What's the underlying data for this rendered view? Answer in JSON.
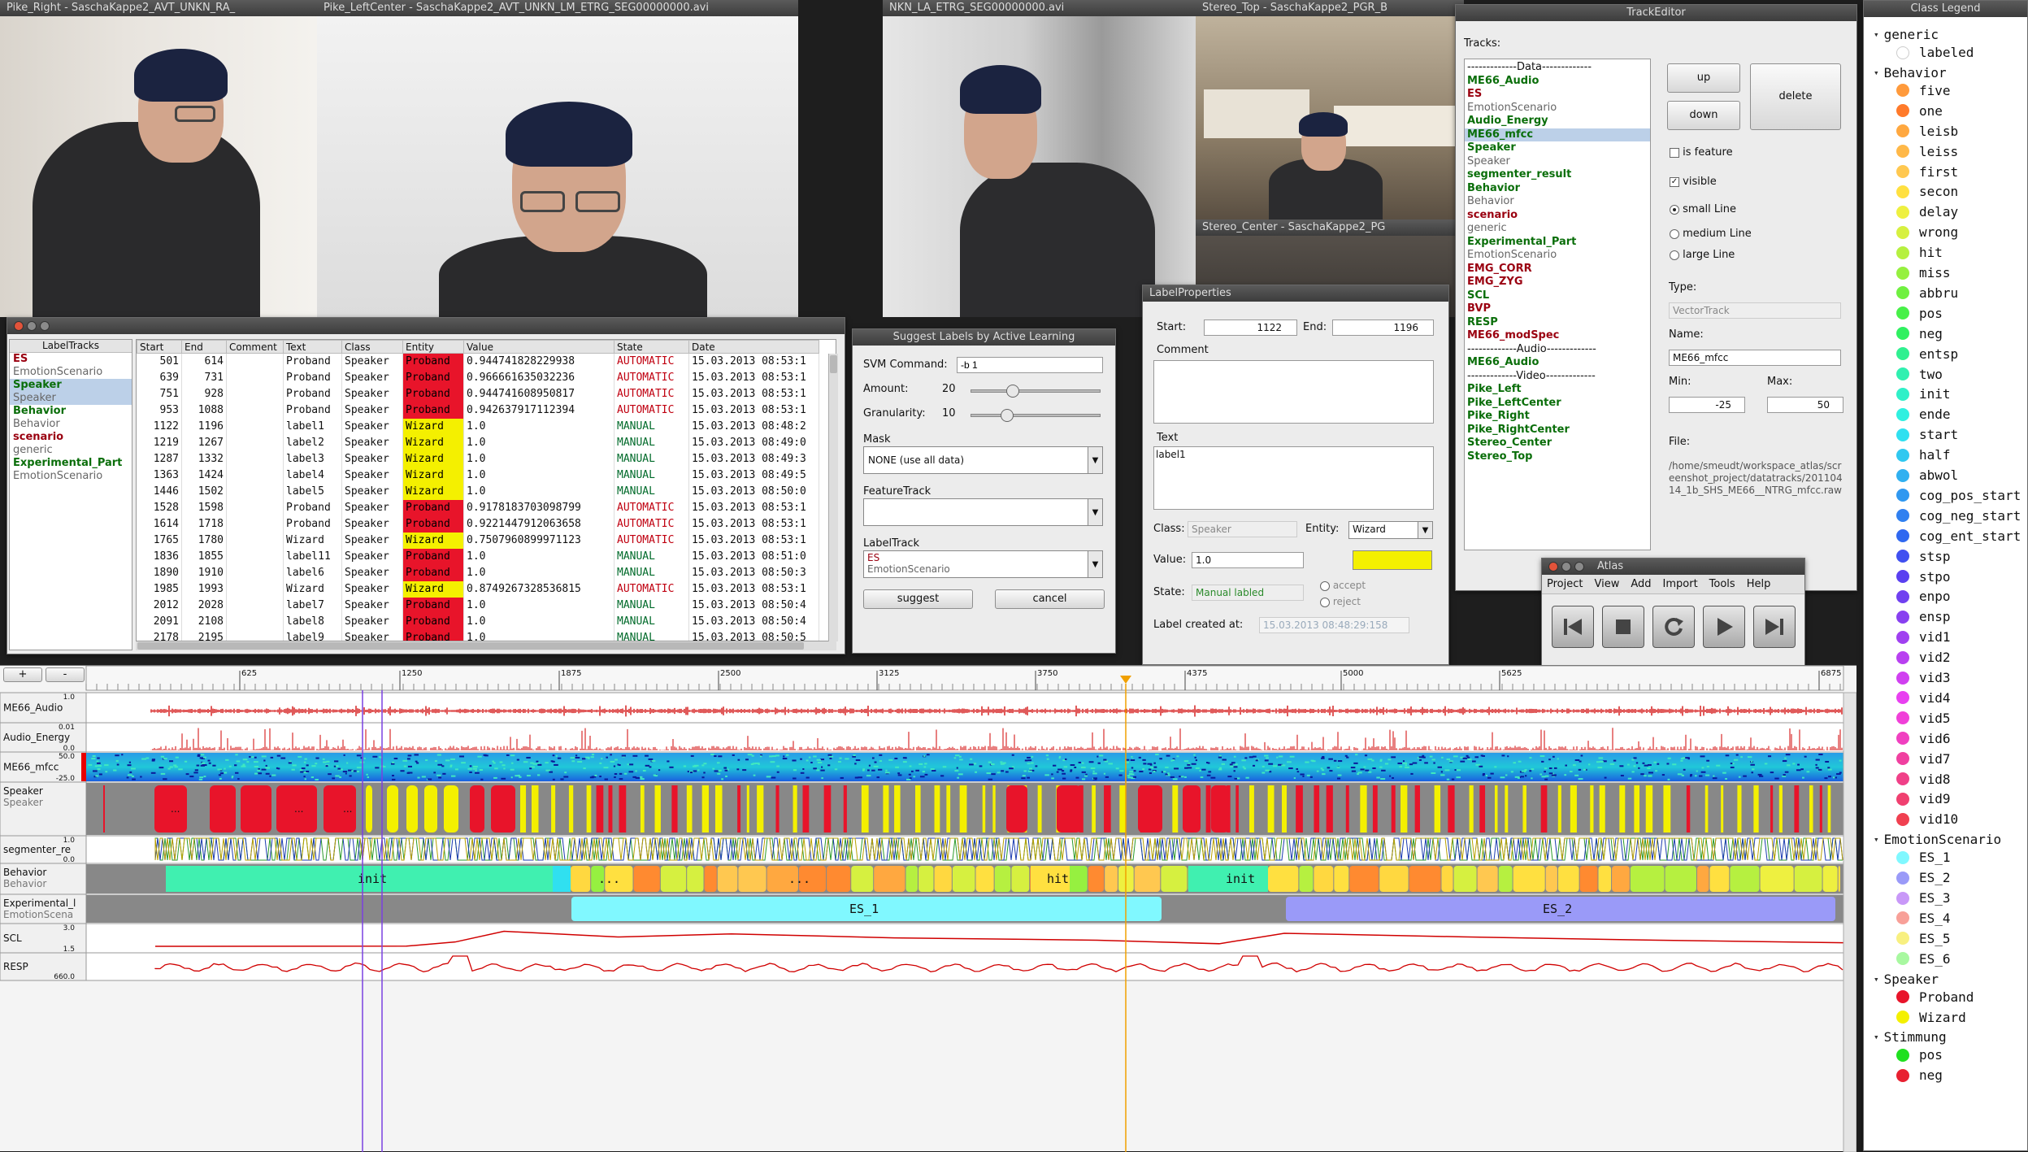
{
  "videos": [
    {
      "title": "Pike_Right - SaschaKappe2_AVT_UNKN_RA_"
    },
    {
      "title": "Pike_LeftCenter - SaschaKappe2_AVT_UNKN_LM_ETRG_SEG00000000.avi"
    },
    {
      "title": "NKN_LA_ETRG_SEG00000000.avi"
    },
    {
      "title": "Stereo_Top - SaschaKappe2_PGR_B"
    },
    {
      "title": "Stereo_Center - SaschaKappe2_PG"
    }
  ],
  "label_tracks": {
    "title": "LabelTracks",
    "items": [
      {
        "name": "ES",
        "sub": "EmotionScenario",
        "color": "#9a0010"
      },
      {
        "name": "Speaker",
        "sub": "Speaker",
        "color": "#0a6e0a"
      },
      {
        "name": "Behavior",
        "sub": "Behavior",
        "color": "#0a6e0a"
      },
      {
        "name": "scenario",
        "sub": "generic",
        "color": "#9a0010"
      },
      {
        "name": "Experimental_Part",
        "sub": "EmotionScenario",
        "color": "#0a6e0a"
      }
    ],
    "columns": [
      "Start",
      "End",
      "Comment",
      "Text",
      "Class",
      "Entity",
      "Value",
      "State",
      "Date"
    ],
    "rows": [
      [
        "501",
        "614",
        "",
        "Proband",
        "Speaker",
        "Proband",
        "0.944741828229938",
        "AUTOMATIC",
        "15.03.2013 08:53:1"
      ],
      [
        "639",
        "731",
        "",
        "Proband",
        "Speaker",
        "Proband",
        "0.966661635032236",
        "AUTOMATIC",
        "15.03.2013 08:53:1"
      ],
      [
        "751",
        "928",
        "",
        "Proband",
        "Speaker",
        "Proband",
        "0.944741608950817",
        "AUTOMATIC",
        "15.03.2013 08:53:1"
      ],
      [
        "953",
        "1088",
        "",
        "Proband",
        "Speaker",
        "Proband",
        "0.942637917112394",
        "AUTOMATIC",
        "15.03.2013 08:53:1"
      ],
      [
        "1122",
        "1196",
        "",
        "label1",
        "Speaker",
        "Wizard",
        "1.0",
        "MANUAL",
        "15.03.2013 08:48:2"
      ],
      [
        "1219",
        "1267",
        "",
        "label2",
        "Speaker",
        "Wizard",
        "1.0",
        "MANUAL",
        "15.03.2013 08:49:0"
      ],
      [
        "1287",
        "1332",
        "",
        "label3",
        "Speaker",
        "Wizard",
        "1.0",
        "MANUAL",
        "15.03.2013 08:49:3"
      ],
      [
        "1363",
        "1424",
        "",
        "label4",
        "Speaker",
        "Wizard",
        "1.0",
        "MANUAL",
        "15.03.2013 08:49:5"
      ],
      [
        "1446",
        "1502",
        "",
        "label5",
        "Speaker",
        "Wizard",
        "1.0",
        "MANUAL",
        "15.03.2013 08:50:0"
      ],
      [
        "1528",
        "1598",
        "",
        "Proband",
        "Speaker",
        "Proband",
        "0.9178183703098799",
        "AUTOMATIC",
        "15.03.2013 08:53:1"
      ],
      [
        "1614",
        "1718",
        "",
        "Proband",
        "Speaker",
        "Proband",
        "0.9221447912063658",
        "AUTOMATIC",
        "15.03.2013 08:53:1"
      ],
      [
        "1765",
        "1780",
        "",
        "Wizard",
        "Speaker",
        "Wizard",
        "0.7507960899971123",
        "AUTOMATIC",
        "15.03.2013 08:53:1"
      ],
      [
        "1836",
        "1855",
        "",
        "label11",
        "Speaker",
        "Proband",
        "1.0",
        "MANUAL",
        "15.03.2013 08:51:0"
      ],
      [
        "1890",
        "1910",
        "",
        "label6",
        "Speaker",
        "Proband",
        "1.0",
        "MANUAL",
        "15.03.2013 08:50:3"
      ],
      [
        "1985",
        "1993",
        "",
        "Wizard",
        "Speaker",
        "Wizard",
        "0.8749267328536815",
        "AUTOMATIC",
        "15.03.2013 08:53:1"
      ],
      [
        "2012",
        "2028",
        "",
        "label7",
        "Speaker",
        "Proband",
        "1.0",
        "MANUAL",
        "15.03.2013 08:50:4"
      ],
      [
        "2091",
        "2108",
        "",
        "label8",
        "Speaker",
        "Proband",
        "1.0",
        "MANUAL",
        "15.03.2013 08:50:4"
      ],
      [
        "2178",
        "2195",
        "",
        "label9",
        "Speaker",
        "Proband",
        "1.0",
        "MANUAL",
        "15.03.2013 08:50:5"
      ]
    ]
  },
  "suggest": {
    "title": "Suggest Labels by Active Learning",
    "svm_label": "SVM Command:",
    "svm_value": "-b 1",
    "amount_label": "Amount:",
    "amount_value": "20",
    "amount_level": 0.3,
    "granularity_label": "Granularity:",
    "granularity_value": "10",
    "granularity_level": 0.25,
    "mask_label": "Mask",
    "mask_value": "NONE (use all data)",
    "feature_label": "FeatureTrack",
    "feature_value": "",
    "labeltrack_label": "LabelTrack",
    "labeltrack_value": "ES",
    "labeltrack_sub": "EmotionScenario",
    "suggest_btn": "suggest",
    "cancel_btn": "cancel"
  },
  "label_props": {
    "title": "LabelProperties",
    "start_label": "Start:",
    "start_value": "1122",
    "end_label": "End:",
    "end_value": "1196",
    "comment_label": "Comment",
    "text_label": "Text",
    "text_value": "label1",
    "class_label": "Class:",
    "class_value": "Speaker",
    "entity_label": "Entity:",
    "entity_value": "Wizard",
    "entity_color": "#f4f000",
    "value_label": "Value:",
    "value_value": "1.0",
    "state_label": "State:",
    "state_value": "Manual labled",
    "accept_label": "accept",
    "reject_label": "reject",
    "created_label": "Label created at:",
    "created_value": "15.03.2013 08:48:29:158"
  },
  "track_editor": {
    "title": "TrackEditor",
    "tracks_label": "Tracks:",
    "items": [
      {
        "text": "-------------Data-------------",
        "kind": "sep"
      },
      {
        "text": "ME66_Audio",
        "kind": "green"
      },
      {
        "text": "ES",
        "kind": "red"
      },
      {
        "text": "EmotionScenario",
        "kind": "gray"
      },
      {
        "text": "Audio_Energy",
        "kind": "green"
      },
      {
        "text": "ME66_mfcc",
        "kind": "green",
        "selected": true
      },
      {
        "text": "Speaker",
        "kind": "green"
      },
      {
        "text": "Speaker",
        "kind": "gray"
      },
      {
        "text": "segmenter_result",
        "kind": "green"
      },
      {
        "text": "Behavior",
        "kind": "green"
      },
      {
        "text": "Behavior",
        "kind": "gray"
      },
      {
        "text": "scenario",
        "kind": "red"
      },
      {
        "text": "generic",
        "kind": "gray"
      },
      {
        "text": "Experimental_Part",
        "kind": "green"
      },
      {
        "text": "EmotionScenario",
        "kind": "gray"
      },
      {
        "text": "EMG_CORR",
        "kind": "red"
      },
      {
        "text": "EMG_ZYG",
        "kind": "red"
      },
      {
        "text": "SCL",
        "kind": "green"
      },
      {
        "text": "BVP",
        "kind": "red"
      },
      {
        "text": "RESP",
        "kind": "green"
      },
      {
        "text": "ME66_modSpec",
        "kind": "red"
      },
      {
        "text": "-------------Audio-------------",
        "kind": "sep"
      },
      {
        "text": "ME66_Audio",
        "kind": "green"
      },
      {
        "text": "-------------Video-------------",
        "kind": "sep"
      },
      {
        "text": "Pike_Left",
        "kind": "green"
      },
      {
        "text": "Pike_LeftCenter",
        "kind": "green"
      },
      {
        "text": "Pike_Right",
        "kind": "green"
      },
      {
        "text": "Pike_RightCenter",
        "kind": "green"
      },
      {
        "text": "Stereo_Center",
        "kind": "green"
      },
      {
        "text": "Stereo_Top",
        "kind": "green"
      }
    ],
    "up_btn": "up",
    "down_btn": "down",
    "delete_btn": "delete",
    "is_feature": "is feature",
    "visible": "visible",
    "small_line": "small Line",
    "medium_line": "medium Line",
    "large_line": "large Line",
    "type_label": "Type:",
    "type_value": "VectorTrack",
    "name_label": "Name:",
    "name_value": "ME66_mfcc",
    "min_label": "Min:",
    "min_value": "-25",
    "max_label": "Max:",
    "max_value": "50",
    "file_label": "File:",
    "file_value": "/home/smeudt/workspace_atlas/screenshot_project/datatracks/20110414_1b_SHS_ME66__NTRG_mfcc.raw"
  },
  "atlas": {
    "title": "Atlas",
    "menu": [
      "Project",
      "View",
      "Add",
      "Import",
      "Tools",
      "Help"
    ]
  },
  "timeline": {
    "plus": "+",
    "minus": "-",
    "ticks": [
      "625",
      "1250",
      "1875",
      "2500",
      "3125",
      "3750",
      "4375",
      "5000",
      "5625",
      "6875"
    ],
    "tracks": [
      {
        "name": "ME66_Audio",
        "sub": "",
        "max": "1.0",
        "min": ""
      },
      {
        "name": "Audio_Energy",
        "sub": "",
        "max": "0.01",
        "min": "0.0"
      },
      {
        "name": "ME66_mfcc",
        "sub": "",
        "max": "50.0",
        "min": "-25.0"
      },
      {
        "name": "Speaker",
        "sub": "Speaker",
        "max": "",
        "min": ""
      },
      {
        "name": "segmenter_re",
        "sub": "",
        "max": "1.0",
        "min": "0.0"
      },
      {
        "name": "Behavior",
        "sub": "Behavior",
        "max": "",
        "min": ""
      },
      {
        "name": "Experimental_l",
        "sub": "EmotionScena",
        "max": "",
        "min": ""
      },
      {
        "name": "SCL",
        "sub": "",
        "max": "3.0",
        "min": "1.5"
      },
      {
        "name": "RESP",
        "sub": "",
        "max": "",
        "min": "660.0"
      }
    ],
    "speaker_dots": [
      "...",
      "...",
      "..."
    ],
    "behavior_labels": [
      "init",
      "...",
      "...",
      "hit",
      "init"
    ],
    "experimental_labels": [
      "ES_1",
      "ES_2"
    ]
  },
  "legend": {
    "title": "Class Legend",
    "groups": [
      {
        "name": "generic",
        "items": [
          {
            "name": "labeled",
            "color": "#ffffff"
          }
        ]
      },
      {
        "name": "Behavior",
        "items": [
          {
            "name": "five",
            "color": "#ff9a3c"
          },
          {
            "name": "one",
            "color": "#ff7a2a"
          },
          {
            "name": "leisb",
            "color": "#ffa840"
          },
          {
            "name": "leiss",
            "color": "#ffb848"
          },
          {
            "name": "first",
            "color": "#ffc850"
          },
          {
            "name": "secon",
            "color": "#ffe040"
          },
          {
            "name": "delay",
            "color": "#eef040"
          },
          {
            "name": "wrong",
            "color": "#d6f040"
          },
          {
            "name": "hit",
            "color": "#b6f040"
          },
          {
            "name": "miss",
            "color": "#96f040"
          },
          {
            "name": "abbru",
            "color": "#70f040"
          },
          {
            "name": "pos",
            "color": "#48f048"
          },
          {
            "name": "neg",
            "color": "#30f060"
          },
          {
            "name": "entsp",
            "color": "#30f090"
          },
          {
            "name": "two",
            "color": "#30f0b0"
          },
          {
            "name": "init",
            "color": "#30f0c8"
          },
          {
            "name": "ende",
            "color": "#30f0e0"
          },
          {
            "name": "start",
            "color": "#30e0f0"
          },
          {
            "name": "half",
            "color": "#30c8f0"
          },
          {
            "name": "abwol",
            "color": "#30b0f0"
          },
          {
            "name": "cog_pos_start",
            "color": "#3098f0"
          },
          {
            "name": "cog_neg_start",
            "color": "#3080f0"
          },
          {
            "name": "cog_ent_start",
            "color": "#3068f0"
          },
          {
            "name": "stsp",
            "color": "#4050f0"
          },
          {
            "name": "stpo",
            "color": "#5a40f0"
          },
          {
            "name": "enpo",
            "color": "#7040f0"
          },
          {
            "name": "ensp",
            "color": "#8840f0"
          },
          {
            "name": "vid1",
            "color": "#a040f0"
          },
          {
            "name": "vid2",
            "color": "#b840f0"
          },
          {
            "name": "vid3",
            "color": "#d040f0"
          },
          {
            "name": "vid4",
            "color": "#e840f0"
          },
          {
            "name": "vid5",
            "color": "#f040d8"
          },
          {
            "name": "vid6",
            "color": "#f040c0"
          },
          {
            "name": "vid7",
            "color": "#f040a0"
          },
          {
            "name": "vid8",
            "color": "#f04088"
          },
          {
            "name": "vid9",
            "color": "#f04070"
          },
          {
            "name": "vid10",
            "color": "#f04050"
          }
        ]
      },
      {
        "name": "EmotionScenario",
        "items": [
          {
            "name": "ES_1",
            "color": "#80f8ff"
          },
          {
            "name": "ES_2",
            "color": "#9a9af8"
          },
          {
            "name": "ES_3",
            "color": "#c898f8"
          },
          {
            "name": "ES_4",
            "color": "#f8a098"
          },
          {
            "name": "ES_5",
            "color": "#f8f080"
          },
          {
            "name": "ES_6",
            "color": "#a8f8a0"
          }
        ]
      },
      {
        "name": "Speaker",
        "items": [
          {
            "name": "Proband",
            "color": "#e8142a"
          },
          {
            "name": "Wizard",
            "color": "#f4f000"
          }
        ]
      },
      {
        "name": "Stimmung",
        "items": [
          {
            "name": "pos",
            "color": "#20e020"
          },
          {
            "name": "neg",
            "color": "#e82030"
          }
        ]
      }
    ]
  }
}
